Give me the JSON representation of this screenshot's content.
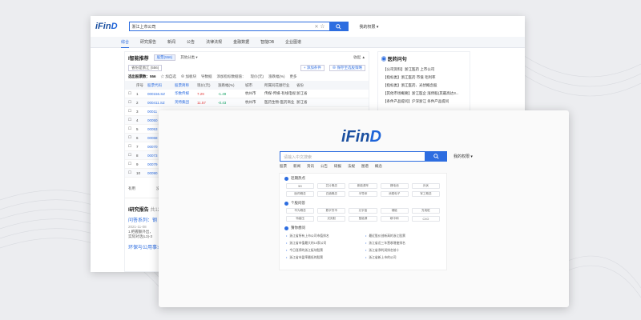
{
  "colors": {
    "brand": "#2d6de0",
    "positive": "#e23b3b",
    "negative": "#0a9e5e"
  },
  "back": {
    "logo": {
      "main": "iFin",
      "accent": "D"
    },
    "search": {
      "value": "浙江上市公司",
      "icon": "search-icon"
    },
    "user": "我的权限 ▾",
    "nav": [
      "综合",
      "研究报告",
      "新闻",
      "公告",
      "法律法规",
      "金融数据",
      "智能DB",
      "企业图谱"
    ],
    "panel": {
      "title": "I智能推荐",
      "filter_chip": "股票(556)",
      "filter_other": "其他分类 ▾",
      "collapse": "收起 ▲",
      "tag": "省份是浙江 (556)",
      "add_cond": "+ 添加条件",
      "save_strategy": "⊕ 保存至选股策略",
      "count_label": "选出股票数：556",
      "toolbar": [
        "☆ 加自选",
        "⊕ 加板块",
        "导数据",
        "添加指标数据值：",
        "现价(元)",
        "涨跌幅(%)",
        "更多"
      ],
      "columns": [
        "",
        "序号",
        "股票代码",
        "股票简称",
        "现价(元)",
        "涨跌幅(%)",
        "城市",
        "所属同花顺行业",
        "省份"
      ],
      "rows": [
        {
          "n": "1",
          "code": "000156.SZ",
          "name": "华数传媒",
          "price": "7.29",
          "chg": "-1.49",
          "city": "杭州市",
          "ind": "传媒-传媒-有线电视",
          "prov": "浙江省"
        },
        {
          "n": "2",
          "code": "000411.SZ",
          "name": "英特集团",
          "price": "11.57",
          "chg": "-0.43",
          "city": "杭州市",
          "ind": "医药生物-医药商业",
          "prov": "浙江省"
        },
        {
          "n": "3",
          "code": "00011",
          "name": "",
          "price": "",
          "chg": "",
          "city": "",
          "ind": "",
          "prov": ""
        },
        {
          "n": "4",
          "code": "00050",
          "name": "",
          "price": "",
          "chg": "",
          "city": "",
          "ind": "",
          "prov": ""
        },
        {
          "n": "5",
          "code": "00053",
          "name": "",
          "price": "",
          "chg": "",
          "city": "",
          "ind": "",
          "prov": ""
        },
        {
          "n": "6",
          "code": "00068",
          "name": "",
          "price": "",
          "chg": "",
          "city": "",
          "ind": "",
          "prov": ""
        },
        {
          "n": "7",
          "code": "00070",
          "name": "",
          "price": "",
          "chg": "",
          "city": "",
          "ind": "",
          "prov": ""
        },
        {
          "n": "8",
          "code": "00073",
          "name": "",
          "price": "",
          "chg": "",
          "city": "",
          "ind": "",
          "prov": ""
        },
        {
          "n": "9",
          "code": "00079",
          "name": "",
          "price": "",
          "chg": "",
          "city": "",
          "ind": "",
          "prov": ""
        },
        {
          "n": "10",
          "code": "00090",
          "name": "",
          "price": "",
          "chg": "",
          "city": "",
          "ind": "",
          "prov": ""
        }
      ],
      "feedback": [
        "有用",
        "没用"
      ],
      "research": {
        "title": "I研究报告",
        "count": "共12",
        "link1": "问答系列：钢",
        "date": "2021-11-08",
        "desc1": "1.把握额外出，",
        "desc2": "实际对话(L3)-3",
        "link2": "环保与公用事业"
      }
    },
    "side": {
      "title": "医药问句",
      "items": [
        "【公司资料】浙江医药 上市公司",
        "【指标类】浙江医药 市值 毛利率",
        "【指标类】浙江医药、光伏概念股",
        "【其他市场概要】浙江医企 涨停股(其最高达3...",
        "【条件产品提问】沪深浙江 条件产品提问"
      ]
    }
  },
  "front": {
    "logo": {
      "main": "iFin",
      "accent": "D"
    },
    "search": {
      "placeholder": "请输入中文搜索",
      "icon": "search-icon"
    },
    "user": "我的权限 ▾",
    "quick": [
      "股票",
      "新闻",
      "资讯",
      "公告",
      "研报",
      "法规",
      "图谱",
      "概念"
    ],
    "sections": [
      {
        "title": "近期热点",
        "chips": [
          "5G",
          "芯片概念",
          "新能源车",
          "锂电池",
          "光伏",
          "医药概念",
          "白酒概念",
          "半导体",
          "消费电子",
          "军工概念"
        ]
      },
      {
        "title": "个股问答",
        "chips": [
          "华为概念",
          "数字货币",
          "元宇宙",
          "储能",
          "充电桩",
          "特高压",
          "光刻胶",
          "氢能源",
          "碳中和",
          "CXO"
        ]
      }
    ],
    "rec_title": "猜你想问",
    "rec": [
      "浙江省所有上市公司市值排名",
      "最近股价创新高的浙江股票",
      "浙江省市值最大的10家公司",
      "浙江省近三年营收增速排名",
      "今日涨停的浙江板块股票",
      "浙江省净利润排名前十",
      "浙江省市盈率最低的股票",
      "浙江省新上市的公司"
    ]
  }
}
